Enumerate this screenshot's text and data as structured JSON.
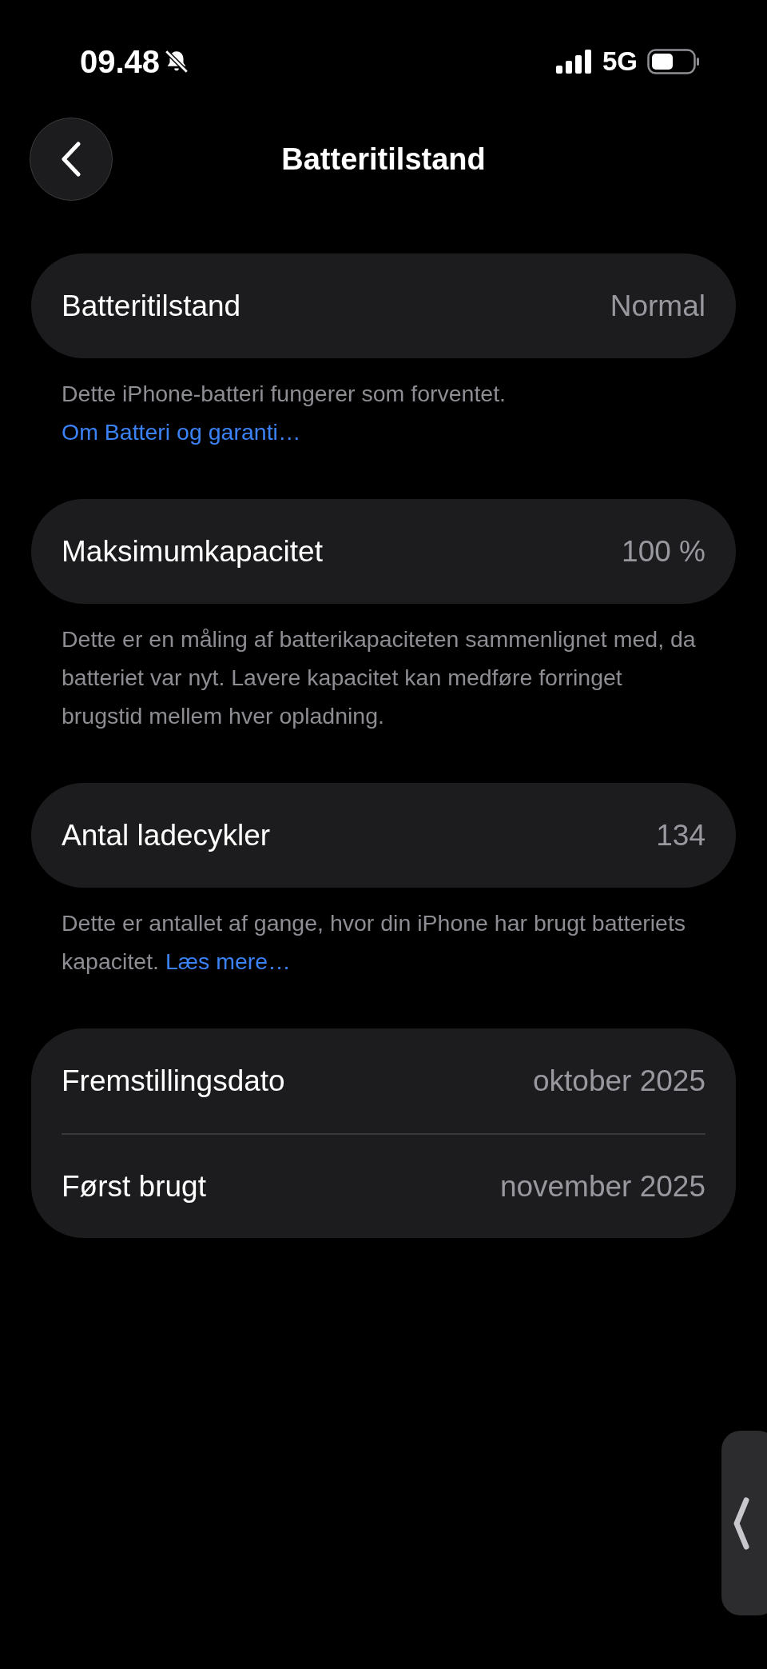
{
  "status_bar": {
    "time": "09.48",
    "network": "5G"
  },
  "nav": {
    "title": "Batteritilstand"
  },
  "sections": [
    {
      "rows": [
        {
          "label": "Batteritilstand",
          "value": "Normal"
        }
      ],
      "footer": {
        "text": "Dette iPhone-batteri fungerer som forventet.",
        "link": "Om Batteri og garanti…"
      }
    },
    {
      "rows": [
        {
          "label": "Maksimumkapacitet",
          "value": "100 %"
        }
      ],
      "footer": {
        "text": "Dette er en måling af batterikapaciteten sammenlignet med, da batteriet var nyt. Lavere kapacitet kan medføre forringet brugstid mellem hver opladning."
      }
    },
    {
      "rows": [
        {
          "label": "Antal ladecykler",
          "value": "134"
        }
      ],
      "footer": {
        "text": "Dette er antallet af gange, hvor din iPhone har brugt batteriets kapacitet.",
        "link": "Læs mere…"
      }
    },
    {
      "rows": [
        {
          "label": "Fremstillingsdato",
          "value": "oktober 2025"
        },
        {
          "label": "Først brugt",
          "value": "november 2025"
        }
      ]
    }
  ]
}
